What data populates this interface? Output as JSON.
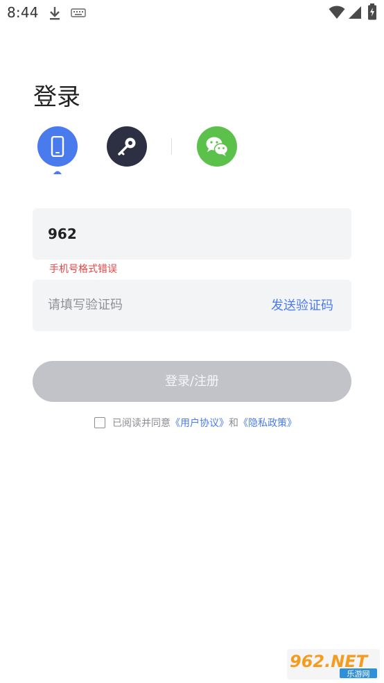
{
  "status_bar": {
    "time": "8:44",
    "icons": [
      "download-icon",
      "keyboard-icon",
      "wifi-icon",
      "signal-icon",
      "battery-charging-icon"
    ]
  },
  "page": {
    "title": "登录"
  },
  "login_methods": [
    {
      "name": "phone",
      "icon": "phone-icon",
      "color": "#4a7bec",
      "selected": true
    },
    {
      "name": "password",
      "icon": "key-icon",
      "color": "#2d3043",
      "selected": false
    },
    {
      "name": "wechat",
      "icon": "wechat-icon",
      "color": "#5bc14a",
      "selected": false
    }
  ],
  "phone_field": {
    "value": "962",
    "error": "手机号格式错误"
  },
  "code_field": {
    "placeholder": "请填写验证码",
    "send_label": "发送验证码"
  },
  "submit": {
    "label": "登录/注册"
  },
  "agreement": {
    "checked": false,
    "prefix": "已阅读并同意",
    "user_agreement": "《用户协议》",
    "and": "和",
    "privacy_policy": "《隐私政策》"
  },
  "watermark": {
    "text": "962.NET",
    "subtext": "乐游网"
  },
  "colors": {
    "accent": "#4a7bec",
    "error": "#e54545",
    "input_bg": "#f3f4f6",
    "disabled_button": "#c1c3c8"
  }
}
